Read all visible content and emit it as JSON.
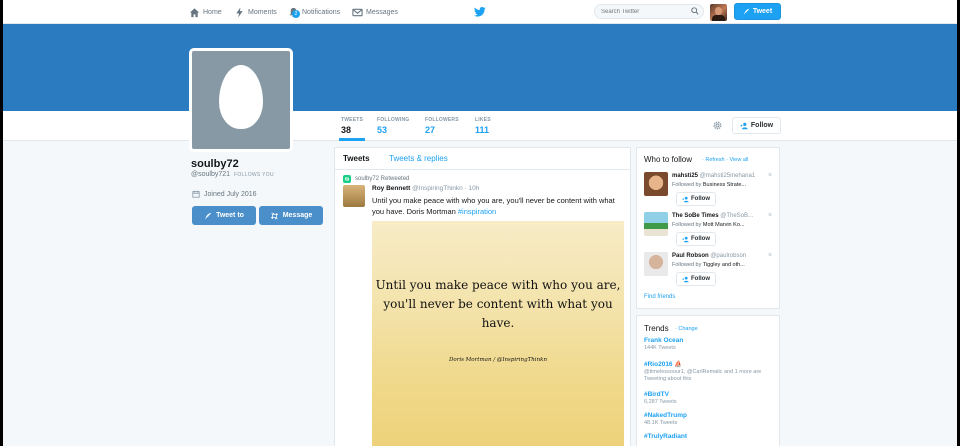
{
  "nav": {
    "home": "Home",
    "moments": "Moments",
    "notifications": "Notifications",
    "notifications_badge": "2",
    "messages": "Messages",
    "search_placeholder": "Search Twitter",
    "tweet_button": "Tweet"
  },
  "stats": {
    "tweets_label": "TWEETS",
    "tweets_value": "38",
    "following_label": "FOLLOWING",
    "following_value": "53",
    "followers_label": "FOLLOWERS",
    "followers_value": "27",
    "likes_label": "LIKES",
    "likes_value": "111",
    "follow_button": "Follow"
  },
  "profile": {
    "name": "soulby72",
    "handle": "@soulby721",
    "follows_you": "FOLLOWS YOU",
    "joined": "Joined July 2016",
    "tweet_to": "Tweet to",
    "message": "Message"
  },
  "timeline": {
    "tab_tweets": "Tweets",
    "tab_replies": "Tweets & replies",
    "retweet_context": "soulby72 Retweeted",
    "author": "Roy Bennett",
    "author_handle": "@InspiringThinkn · 10h",
    "text": "Until you make peace with who you are, you'll never be content with what you have. Doris Mortman ",
    "hashtag": "#inspiration",
    "image_quote": "Until you make peace with who you are, you'll never be content with what you have.",
    "image_signature": "Doris Mortman / @InspiringThinkn"
  },
  "who_to_follow": {
    "heading": "Who to follow",
    "refresh": "· Refresh · View all",
    "follow_label": "Follow",
    "find_friends": "Find friends",
    "items": [
      {
        "name": "mahsti25",
        "handle": "@mahsti25mehana1",
        "followed_by_prefix": "Followed by ",
        "followed_by": "Business Strate..."
      },
      {
        "name": "The SoBe Times",
        "handle": "@TheSoB...",
        "followed_by_prefix": "Followed by ",
        "followed_by": "Mott Marvin Ko..."
      },
      {
        "name": "Paul Robson",
        "handle": "@paulrobson",
        "followed_by_prefix": "Followed by ",
        "followed_by": "Tiggley and oth..."
      }
    ]
  },
  "trends": {
    "heading": "Trends",
    "change": "· Change",
    "items": [
      {
        "name": "Frank Ocean",
        "meta": "144K Tweets"
      },
      {
        "name": "#Rio2016",
        "meta": "@timelessoour1, @CarlRemalic and 1 more are Tweeting about this"
      },
      {
        "name": "#BirdTV",
        "meta": "6,287 Tweets"
      },
      {
        "name": "#NakedTrump",
        "meta": "48.1K Tweets"
      },
      {
        "name": "#TrulyRadiant",
        "meta": ""
      }
    ]
  },
  "colors": {
    "banner": "#2a7bc0",
    "accent": "#1da1f2",
    "profile_button": "#4b8fca",
    "retweet_green": "#19cf86"
  }
}
